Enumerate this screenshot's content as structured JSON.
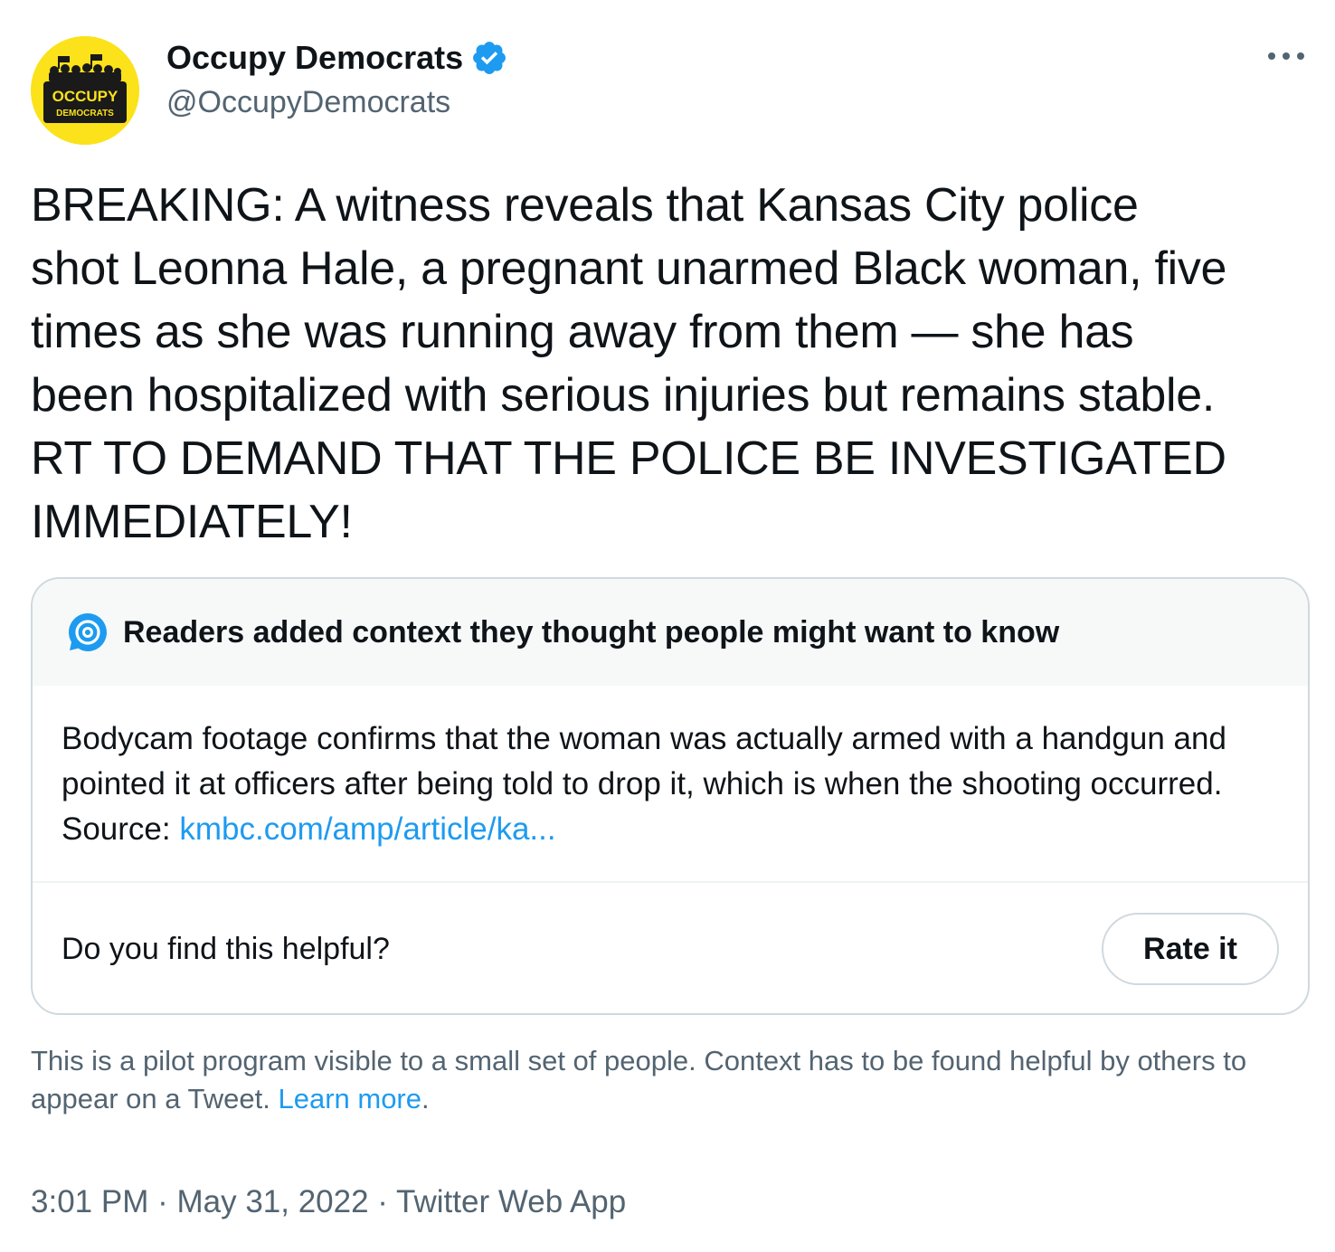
{
  "author": {
    "display_name": "Occupy Democrats",
    "handle": "@OccupyDemocrats",
    "avatar_text_top": "OCCUPY",
    "avatar_text_bottom": "DEMOCRATS",
    "avatar_color": "#fbe21a",
    "verified_color": "#1d9bf0"
  },
  "tweet": {
    "text": "BREAKING: A witness reveals that Kansas City police\nshot Leonna Hale, a pregnant unarmed Black woman, five\ntimes as she was running away from them — she has\nbeen hospitalized with serious injuries but remains stable.\nRT TO DEMAND THAT THE POLICE BE INVESTIGATED\nIMMEDIATELY!",
    "time": "3:01 PM",
    "date": "May 31, 2022",
    "source": "Twitter Web App"
  },
  "note": {
    "title": "Readers added context they thought people might want to know",
    "body": "Bodycam footage confirms that the woman was actually armed with a handgun and pointed it at officers after being told to drop it, which is when the shooting occurred. Source: ",
    "link_text": "kmbc.com/amp/article/ka...",
    "question": "Do you find this helpful?",
    "rate_label": "Rate it"
  },
  "pilot": {
    "text": "This is a pilot program visible to a small set of people. Context has to be found helpful by others to appear on a Tweet. ",
    "link_text": "Learn more",
    "end": "."
  },
  "separator": " · ",
  "colors": {
    "link": "#1d9bf0",
    "secondary_text": "#536471",
    "border": "#cfd9de"
  }
}
